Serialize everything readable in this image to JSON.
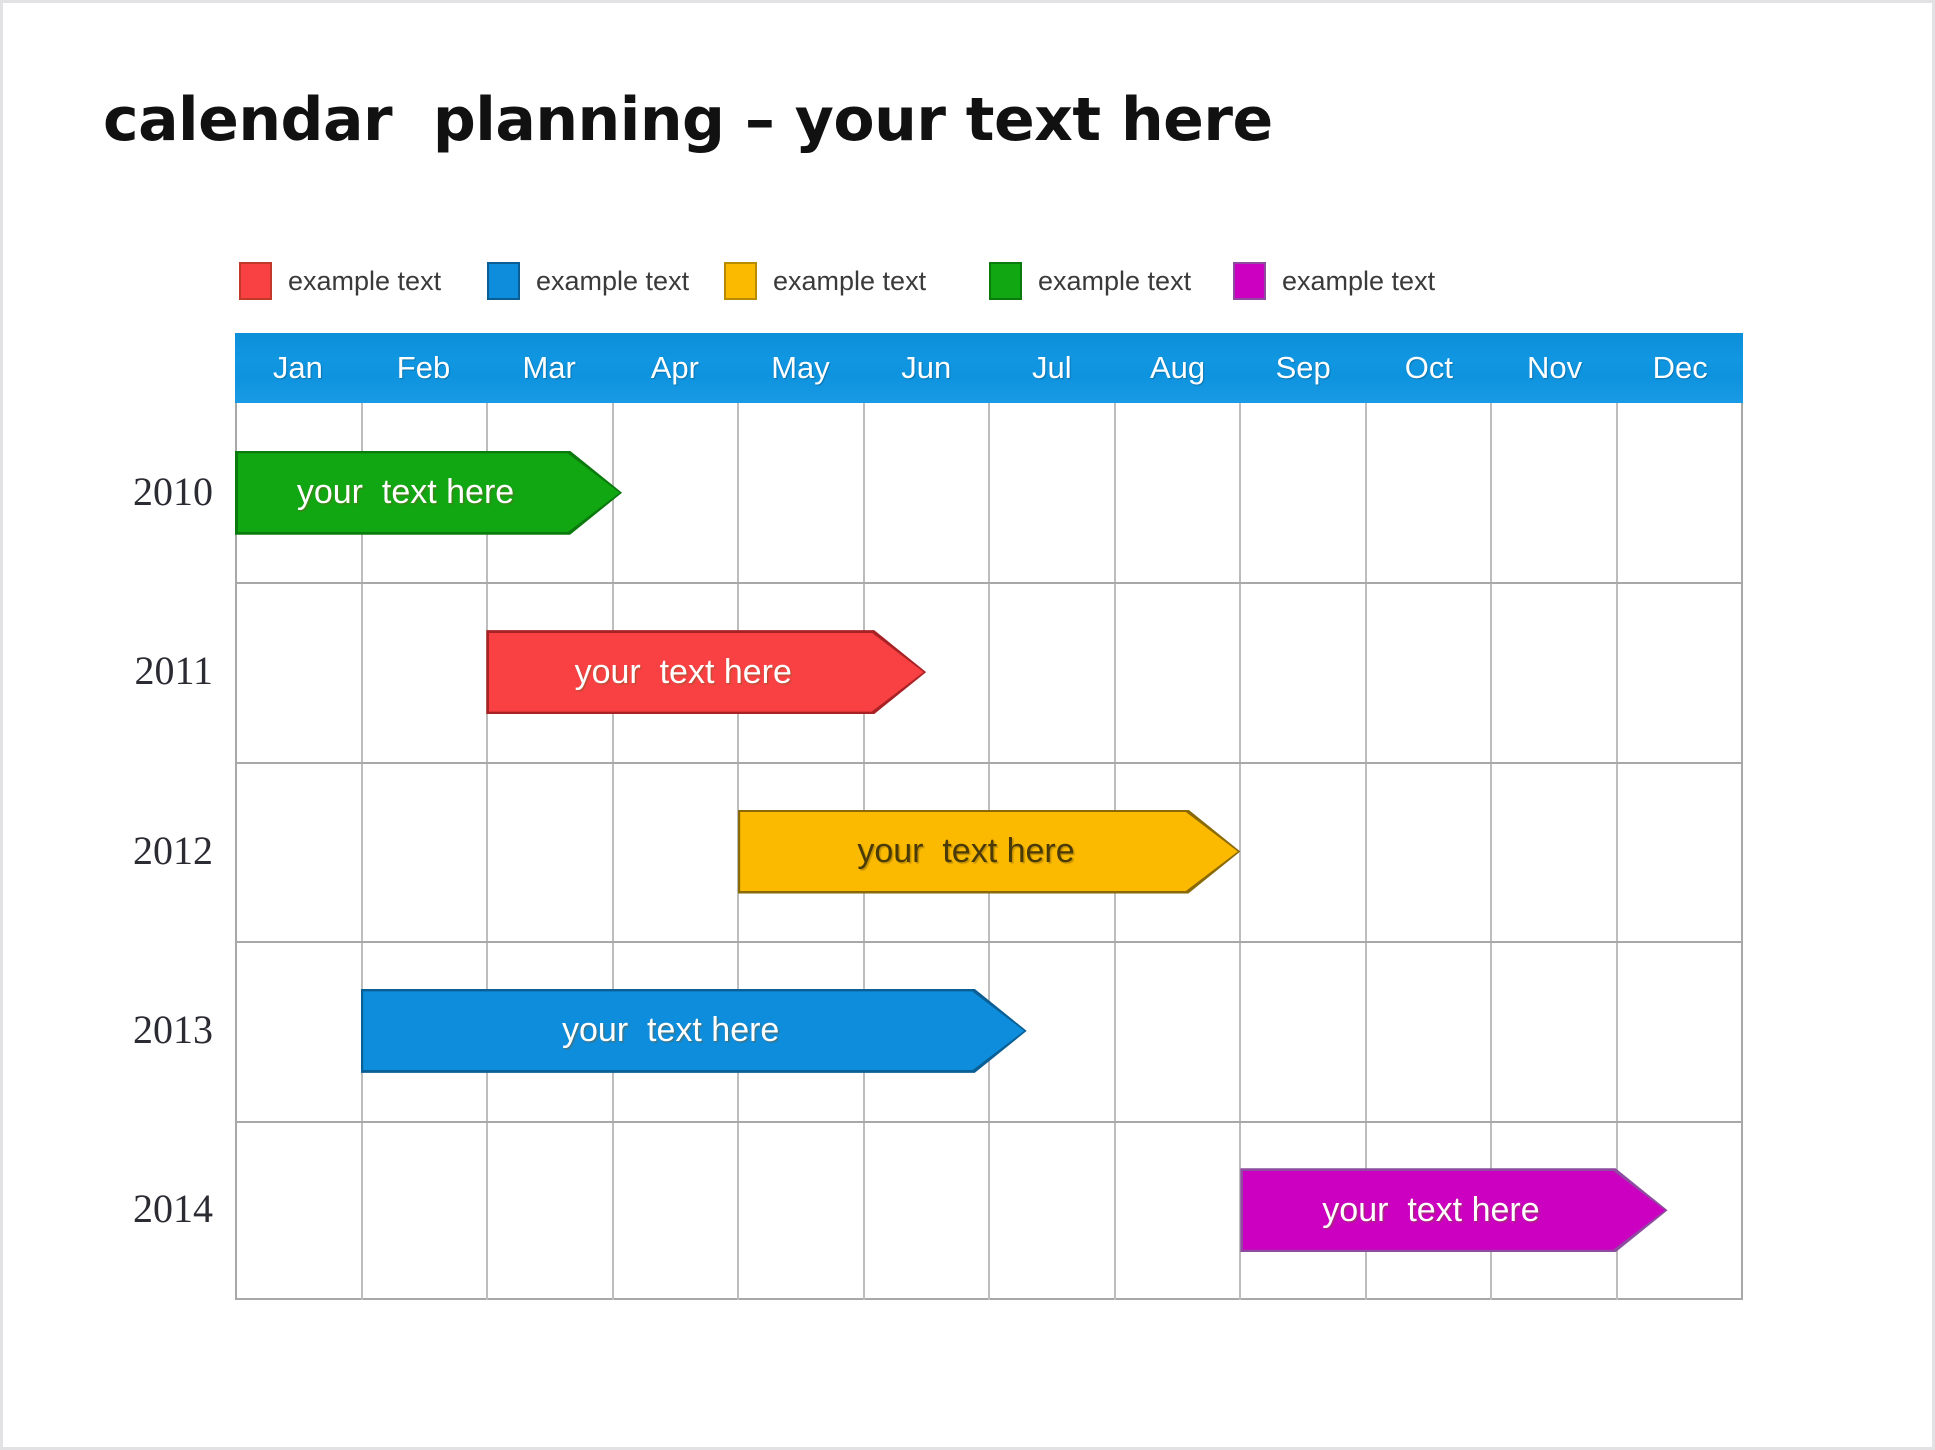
{
  "title": "calendar  planning – your text here",
  "legend": {
    "items": [
      {
        "label": "example text",
        "color": "#f94144",
        "border": "#c0392b"
      },
      {
        "label": "example text",
        "color": "#0d8ddb",
        "border": "#0b5e93"
      },
      {
        "label": "example text",
        "color": "#fbba00",
        "border": "#b98b00"
      },
      {
        "label": "example text",
        "color": "#10a712",
        "border": "#0a7a0d"
      },
      {
        "label": "example text",
        "color": "#cc00c0",
        "border": "#8e4ba0"
      }
    ]
  },
  "calendar": {
    "months": [
      "Jan",
      "Feb",
      "Mar",
      "Apr",
      "May",
      "Jun",
      "Jul",
      "Aug",
      "Sep",
      "Oct",
      "Nov",
      "Dec"
    ],
    "header_color": "#0d90dc",
    "grid_line_color": "#bdbdbd",
    "years": [
      "2010",
      "2011",
      "2012",
      "2013",
      "2014"
    ]
  },
  "chart_data": {
    "type": "bar",
    "title": "calendar  planning – your text here",
    "xlabel": "",
    "ylabel": "",
    "grid": true,
    "legend_position": "top",
    "categories": [
      "Jan",
      "Feb",
      "Mar",
      "Apr",
      "May",
      "Jun",
      "Jul",
      "Aug",
      "Sep",
      "Oct",
      "Nov",
      "Dec"
    ],
    "rows": [
      "2010",
      "2011",
      "2012",
      "2013",
      "2014"
    ],
    "bars": [
      {
        "row": "2010",
        "label": "your  text here",
        "start_month": "Jan",
        "end_month": "Apr",
        "start_index": 0,
        "end_index": 3.08,
        "color": "#10a712",
        "border": "#0a7a0d",
        "text_color": "#ffffff"
      },
      {
        "row": "2011",
        "label": "your  text here",
        "start_month": "Mar",
        "end_month": "Jun",
        "start_index": 2,
        "end_index": 5.5,
        "color": "#f94144",
        "border": "#a82225",
        "text_color": "#ffffff"
      },
      {
        "row": "2012",
        "label": "your  text here",
        "start_month": "May",
        "end_month": "Sep",
        "start_index": 4,
        "end_index": 8.0,
        "color": "#fbba00",
        "border": "#8a6a06",
        "text_color": "#4a3a08"
      },
      {
        "row": "2013",
        "label": "your  text here",
        "start_month": "Feb",
        "end_month": "Jul",
        "start_index": 1,
        "end_index": 6.3,
        "color": "#0d8ddb",
        "border": "#0a5f95",
        "text_color": "#ffffff"
      },
      {
        "row": "2014",
        "label": "your  text here",
        "start_month": "Sep",
        "end_month": "Dec",
        "start_index": 8,
        "end_index": 11.4,
        "color": "#cc00c0",
        "border": "#8e4ba0",
        "text_color": "#ffffff"
      }
    ]
  }
}
